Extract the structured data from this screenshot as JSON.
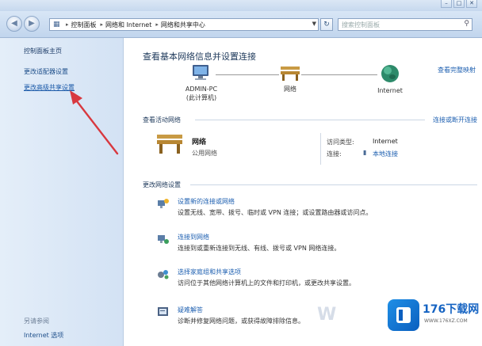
{
  "window": {
    "minimize": "–",
    "maximize": "□",
    "close": "✕"
  },
  "address_bar": {
    "crumbs": [
      "控制面板",
      "网络和 Internet",
      "网络和共享中心"
    ],
    "refresh": "↻",
    "search_placeholder": "搜索控制面板"
  },
  "sidebar": {
    "home": "控制面板主页",
    "adapter": "更改适配器设置",
    "advanced": "更改高级共享设置",
    "see_also": "另请参阅",
    "internet_options": "Internet 选项"
  },
  "main": {
    "title": "查看基本网络信息并设置连接",
    "full_map_link": "查看完整映射",
    "map": {
      "computer_name": "ADMIN-PC",
      "computer_sub": "(此计算机)",
      "network_name": "网络",
      "internet_name": "Internet"
    },
    "active_section": {
      "heading": "查看活动网络",
      "link": "连接或断开连接",
      "network_name": "网络",
      "network_type": "公用网络",
      "access_type_label": "访问类型:",
      "access_type_value": "Internet",
      "connections_label": "连接:",
      "connections_value": "本地连接"
    },
    "change_section": {
      "heading": "更改网络设置",
      "tasks": [
        {
          "title": "设置新的连接或网络",
          "desc": "设置无线、宽带、拨号、临时或 VPN 连接；或设置路由器或访问点。",
          "icon": "new-connection-icon"
        },
        {
          "title": "连接到网络",
          "desc": "连接到或重新连接到无线、有线、拨号或 VPN 网络连接。",
          "icon": "connect-network-icon"
        },
        {
          "title": "选择家庭组和共享选项",
          "desc": "访问位于其他网络计算机上的文件和打印机，或更改共享设置。",
          "icon": "homegroup-icon"
        },
        {
          "title": "疑难解答",
          "desc": "诊断并修复网络问题，或获得故障排除信息。",
          "icon": "troubleshoot-icon"
        }
      ]
    }
  },
  "watermark": {
    "brand": "176下载网",
    "url": "WWW.176XZ.COM"
  },
  "colors": {
    "link": "#1d5fb0",
    "sidebar_bg": "#dce8f6",
    "arrow": "#d8383f"
  }
}
